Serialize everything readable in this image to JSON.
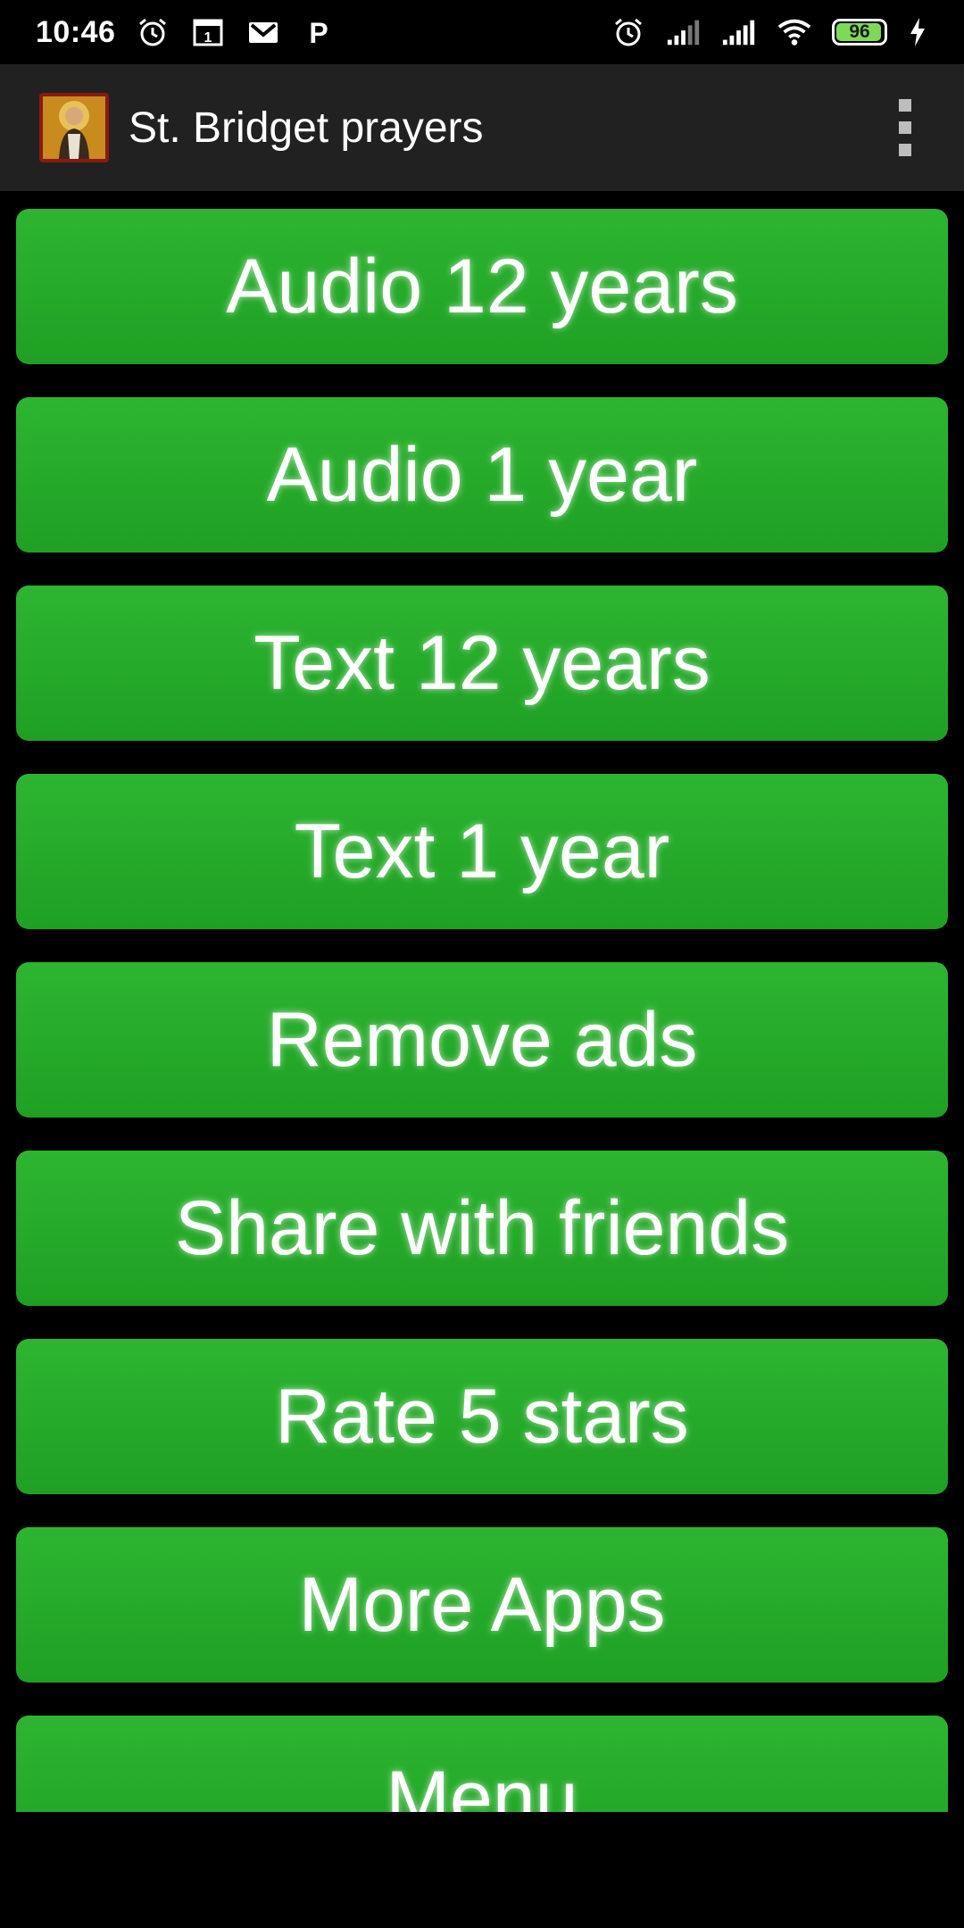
{
  "status_bar": {
    "time": "10:46",
    "left_icons": [
      "alarm-clock-icon",
      "calendar-icon",
      "gmail-icon",
      "p-icon"
    ],
    "right_icons": [
      "alarm-icon",
      "signal-icon",
      "signal-icon",
      "wifi-icon",
      "battery-icon",
      "charging-icon"
    ],
    "battery_percent": "96",
    "battery_level": 0.96,
    "calendar_day": "1",
    "p_letter": "P"
  },
  "action_bar": {
    "title": "St. Bridget prayers",
    "app_icon": "saint-icon",
    "overflow_icon": "more-vert-icon"
  },
  "colors": {
    "button_green": "#27ae2b",
    "action_bar_bg": "#212121",
    "background": "#000000",
    "battery_green": "#7ed957"
  },
  "menu": {
    "items": [
      {
        "label": "Audio 12 years"
      },
      {
        "label": "Audio 1 year"
      },
      {
        "label": "Text 12 years"
      },
      {
        "label": "Text 1 year"
      },
      {
        "label": "Remove ads"
      },
      {
        "label": "Share with friends"
      },
      {
        "label": "Rate 5 stars"
      },
      {
        "label": "More Apps"
      },
      {
        "label": "Menu"
      }
    ]
  }
}
